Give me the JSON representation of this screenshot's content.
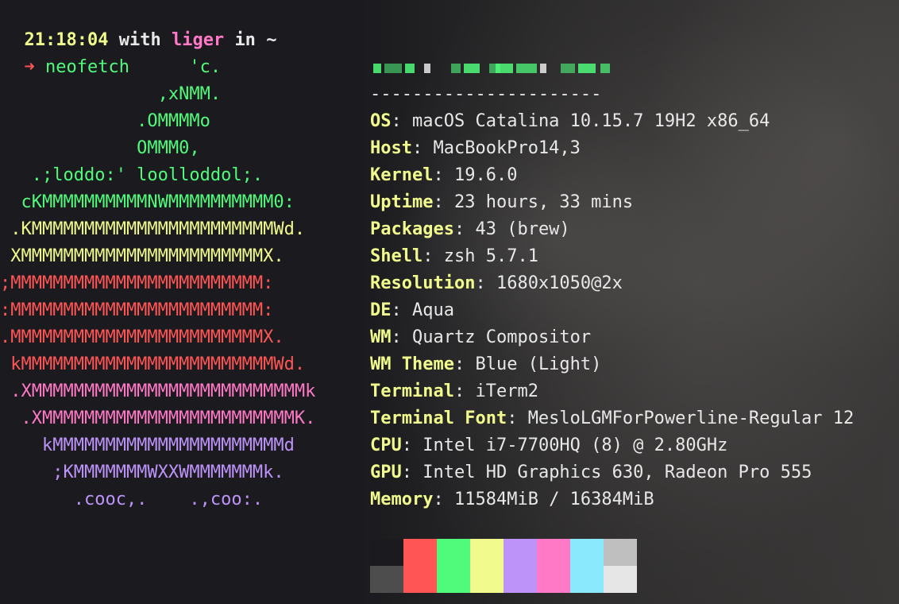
{
  "prompt": {
    "time": "21:18:04",
    "with": "with",
    "user": "liger",
    "in": "in",
    "dir": "~",
    "arrow": "➜",
    "command": "neofetch"
  },
  "logo_lines": [
    {
      "text": "                  'c.",
      "color": "green"
    },
    {
      "text": "               ,xNMM.",
      "color": "green"
    },
    {
      "text": "             .OMMMMo",
      "color": "green"
    },
    {
      "text": "             OMMM0,",
      "color": "green"
    },
    {
      "text": "   .;loddo:' loolloddol;.",
      "color": "green"
    },
    {
      "text": "  cKMMMMMMMMMMNWMMMMMMMMMM0:",
      "color": "green"
    },
    {
      "text": " .KMMMMMMMMMMMMMMMMMMMMMMMWd.",
      "color": "yellow"
    },
    {
      "text": " XMMMMMMMMMMMMMMMMMMMMMMMX.",
      "color": "yellow"
    },
    {
      "text": ";MMMMMMMMMMMMMMMMMMMMMMMM:",
      "color": "red"
    },
    {
      "text": ":MMMMMMMMMMMMMMMMMMMMMMMM:",
      "color": "red"
    },
    {
      "text": ".MMMMMMMMMMMMMMMMMMMMMMMMX.",
      "color": "red"
    },
    {
      "text": " kMMMMMMMMMMMMMMMMMMMMMMMMWd.",
      "color": "red"
    },
    {
      "text": " .XMMMMMMMMMMMMMMMMMMMMMMMMMMk",
      "color": "pink"
    },
    {
      "text": "  .XMMMMMMMMMMMMMMMMMMMMMMMMK.",
      "color": "pink"
    },
    {
      "text": "    kMMMMMMMMMMMMMMMMMMMMMMd",
      "color": "purple"
    },
    {
      "text": "     ;KMMMMMMMWXXWMMMMMMMk.",
      "color": "purple"
    },
    {
      "text": "       .cooc,.    .,coo:.",
      "color": "purple"
    }
  ],
  "info": {
    "separator": "----------------------",
    "rows": [
      {
        "key": "OS",
        "value": "macOS Catalina 10.15.7 19H2 x86_64"
      },
      {
        "key": "Host",
        "value": "MacBookPro14,3"
      },
      {
        "key": "Kernel",
        "value": "19.6.0"
      },
      {
        "key": "Uptime",
        "value": "23 hours, 33 mins"
      },
      {
        "key": "Packages",
        "value": "43 (brew)"
      },
      {
        "key": "Shell",
        "value": "zsh 5.7.1"
      },
      {
        "key": "Resolution",
        "value": "1680x1050@2x"
      },
      {
        "key": "DE",
        "value": "Aqua"
      },
      {
        "key": "WM",
        "value": "Quartz Compositor"
      },
      {
        "key": "WM Theme",
        "value": "Blue (Light)"
      },
      {
        "key": "Terminal",
        "value": "iTerm2"
      },
      {
        "key": "Terminal Font",
        "value": "MesloLGMForPowerline-Regular 12"
      },
      {
        "key": "CPU",
        "value": "Intel i7-7700HQ (8) @ 2.80GHz"
      },
      {
        "key": "GPU",
        "value": "Intel HD Graphics 630, Radeon Pro 555"
      },
      {
        "key": "Memory",
        "value": "11584MiB / 16384MiB"
      }
    ]
  },
  "colors": {
    "green": "#50fa7b",
    "yellow": "#f1fa8c",
    "red": "#ff5555",
    "pink": "#ff79c6",
    "purple": "#bd93f9"
  },
  "swatches": {
    "top": [
      "#1b1b1f",
      "#ff5555",
      "#50fa7b",
      "#f1fa8c",
      "#bd93f9",
      "#ff79c6",
      "#8be9fd",
      "#bfbfbf"
    ],
    "bottom": [
      "#4d4d4d",
      "#ff5555",
      "#50fa7b",
      "#f1fa8c",
      "#bd93f9",
      "#ff79c6",
      "#8be9fd",
      "#e6e6e6"
    ]
  }
}
